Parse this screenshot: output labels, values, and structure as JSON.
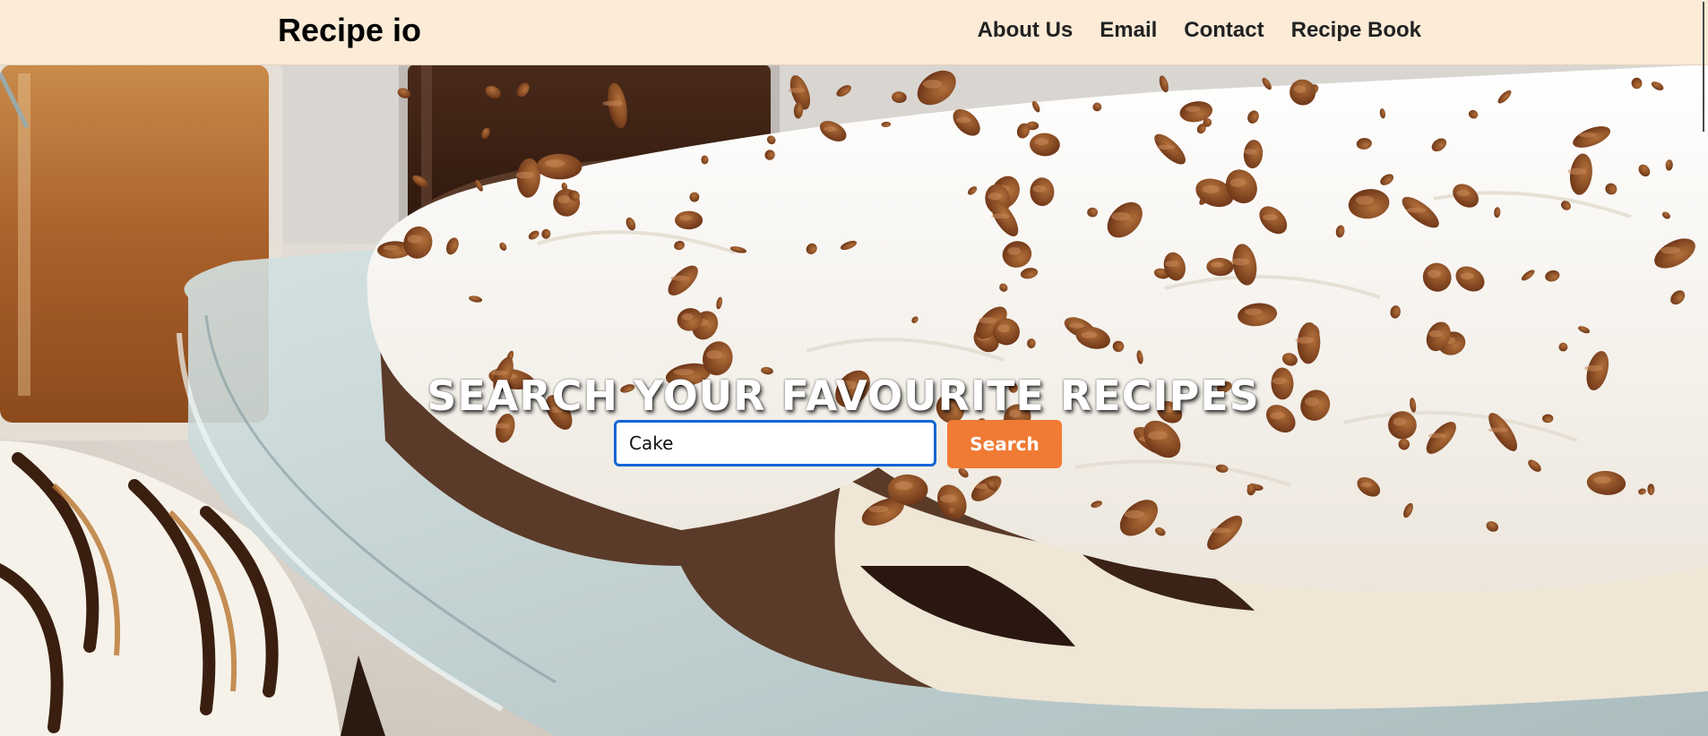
{
  "header": {
    "brand": "Recipe io",
    "nav": [
      {
        "label": "About Us"
      },
      {
        "label": "Email"
      },
      {
        "label": "Contact"
      },
      {
        "label": "Recipe Book"
      }
    ]
  },
  "hero": {
    "title": "SEARCH YOUR FAVOURITE RECIPES",
    "background_image": "cake-photo",
    "search": {
      "value": "Cake",
      "button_label": "Search"
    }
  },
  "colors": {
    "navbar_bg": "#fbebd7",
    "search_button": "#f07b34",
    "input_focus_border": "#1166d6"
  }
}
